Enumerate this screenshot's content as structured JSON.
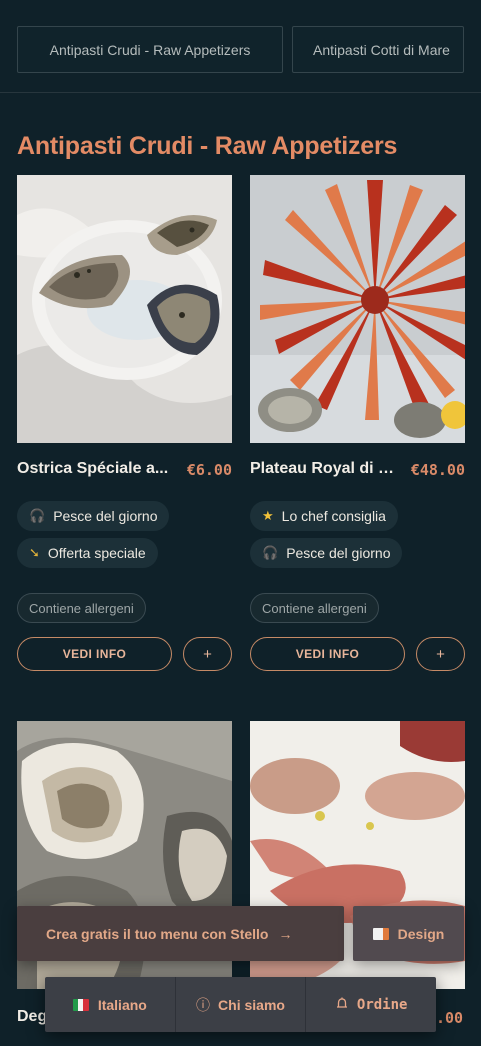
{
  "tabs": [
    "Antipasti Crudi - Raw Appetizers",
    "Antipasti Cotti di Mare"
  ],
  "section_title": "Antipasti Crudi - Raw Appetizers",
  "items": [
    {
      "name": "Ostrica Spéciale a...",
      "price": "€6.00",
      "tags": [
        {
          "icon": "fish-icon",
          "label": "Pesce del giorno"
        },
        {
          "icon": "offer-icon",
          "label": "Offerta speciale"
        }
      ],
      "allergen_label": "Contiene allergeni",
      "info_label": "VEDI INFO",
      "add_label": "+"
    },
    {
      "name": "Plateau Royal di c...",
      "price": "€48.00",
      "tags": [
        {
          "icon": "star-icon",
          "label": "Lo chef consiglia"
        },
        {
          "icon": "fish-icon",
          "label": "Pesce del giorno"
        }
      ],
      "allergen_label": "Contiene allergeni",
      "info_label": "VEDI INFO",
      "add_label": "+"
    }
  ],
  "peek": {
    "name": "Deg",
    "price": ".00"
  },
  "promo": {
    "label": "Crea gratis il tuo menu con Stello",
    "arrow": "→"
  },
  "design_label": "Design",
  "bottom_bar": {
    "language": "Italiano",
    "about": "Chi siamo",
    "order": "Ordine"
  },
  "colors": {
    "background": "#0f2129",
    "accent": "#e38b65",
    "card_tag": "#1c3038"
  }
}
